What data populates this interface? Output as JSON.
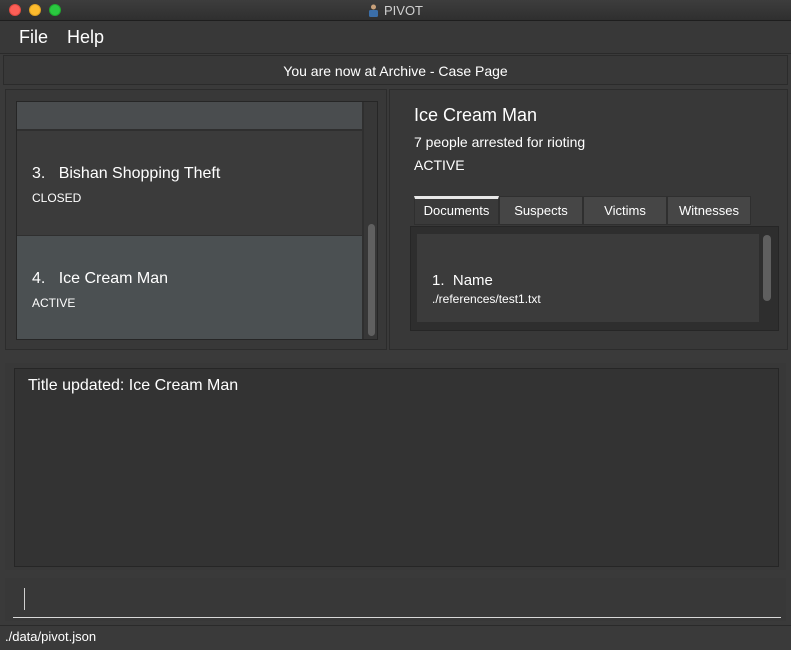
{
  "window": {
    "title": "PIVOT"
  },
  "menu": {
    "file": "File",
    "help": "Help"
  },
  "location": {
    "text": "You are now at Archive - Case Page"
  },
  "case_list": [
    {
      "index": "3.",
      "title": "Bishan Shopping Theft",
      "status": "CLOSED"
    },
    {
      "index": "4.",
      "title": "Ice Cream Man",
      "status": "ACTIVE"
    }
  ],
  "detail": {
    "title": "Ice Cream Man",
    "description": "7 people arrested for rioting",
    "status": "ACTIVE",
    "tabs": [
      "Documents",
      "Suspects",
      "Victims",
      "Witnesses"
    ],
    "active_tab": "Documents",
    "documents": [
      {
        "index": "1.",
        "name": "Name",
        "path": "./references/test1.txt"
      }
    ]
  },
  "result": {
    "text": "Title updated: Ice Cream Man"
  },
  "command": {
    "value": ""
  },
  "status_bar": {
    "path": "./data/pivot.json"
  },
  "colors": {
    "background": "#3a3a3a",
    "selected_card": "#4b5052",
    "text": "#ffffff"
  }
}
